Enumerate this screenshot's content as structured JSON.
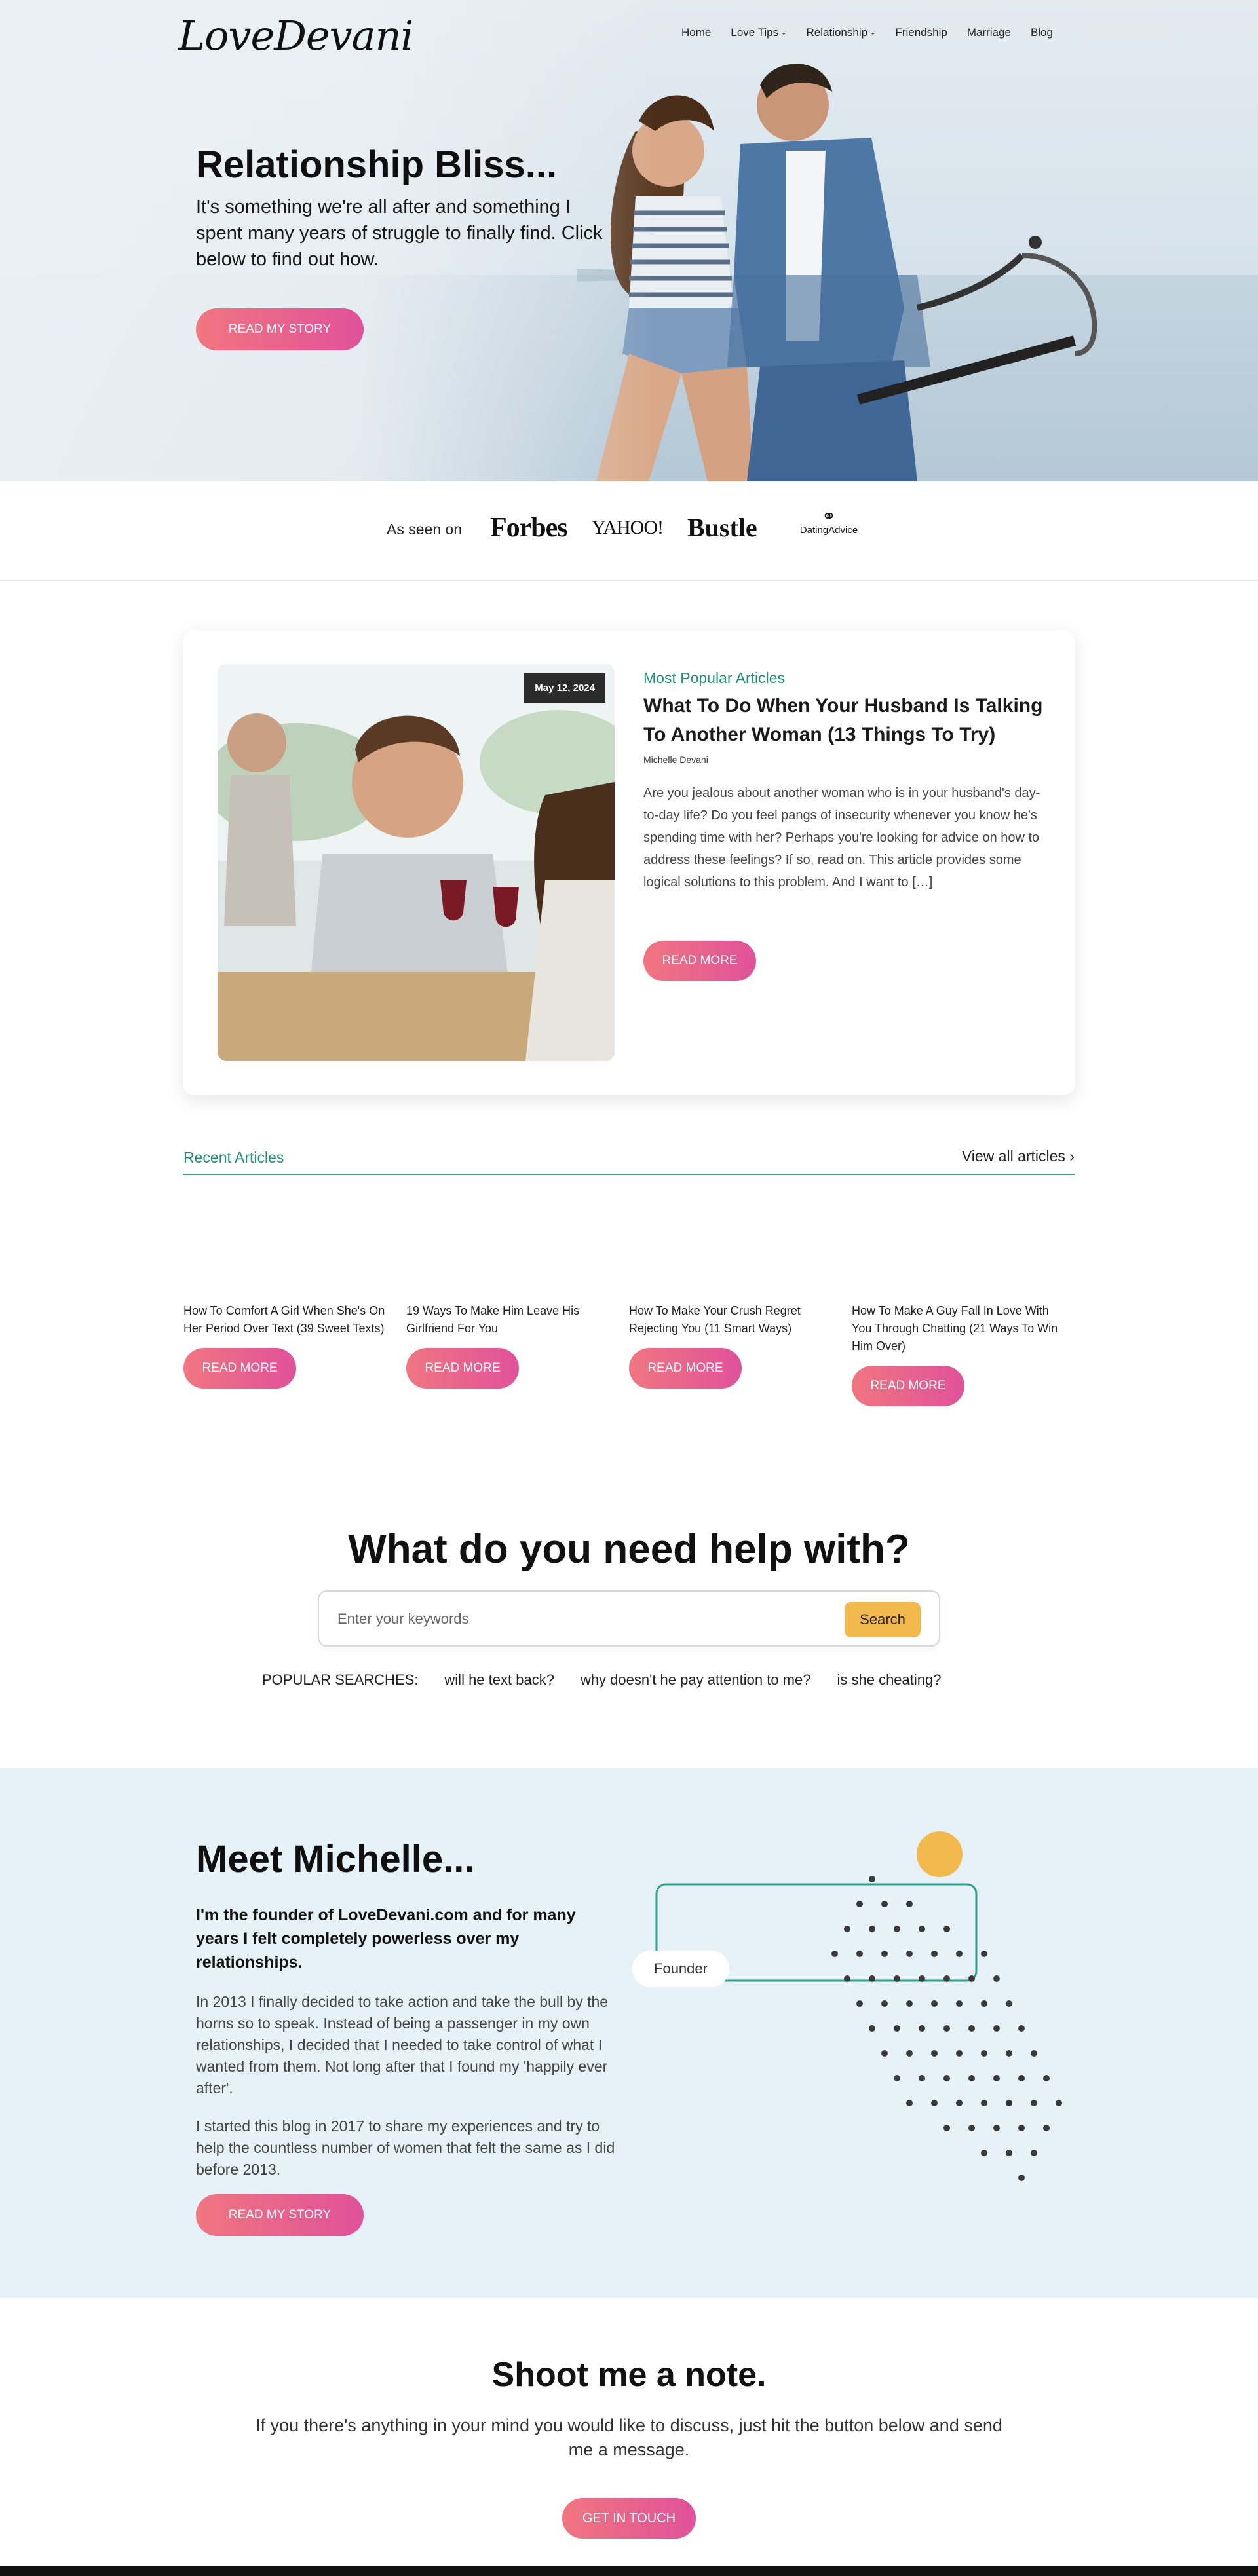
{
  "brand": {
    "logo": "LoveDevani"
  },
  "nav": {
    "items": [
      {
        "label": "Home",
        "has_dropdown": false
      },
      {
        "label": "Love Tips",
        "has_dropdown": true
      },
      {
        "label": "Relationship",
        "has_dropdown": true
      },
      {
        "label": "Friendship",
        "has_dropdown": false
      },
      {
        "label": "Marriage",
        "has_dropdown": false
      },
      {
        "label": "Blog",
        "has_dropdown": false
      }
    ]
  },
  "hero": {
    "title": "Relationship Bliss...",
    "subtitle": "It's something we're all after and something I spent many years of struggle to finally find. Click below to find out how.",
    "button": "READ MY STORY"
  },
  "seen_on": {
    "label": "As seen on",
    "brands": [
      "Forbes",
      "YAHOO!",
      "Bustle",
      "DatingAdvice"
    ]
  },
  "featured": {
    "date": "May 12, 2024",
    "kicker": "Most Popular Articles",
    "title": "What To Do When Your Husband Is Talking To Another Woman (13 Things To Try)",
    "author": "Michelle Devani",
    "excerpt": "Are you jealous about another woman who is in your husband's day-to-day life?  Do you feel pangs of insecurity whenever you know he's spending time with her? Perhaps you're looking for advice on how to address these feelings?  If so, read on. This article provides some logical solutions to this problem.  And I want to […]",
    "button": "READ MORE"
  },
  "recent": {
    "label": "Recent Articles",
    "view_all": "View all articles",
    "articles": [
      {
        "title": "How To Comfort A Girl When She's On Her Period Over Text (39 Sweet Texts)",
        "button": "READ MORE"
      },
      {
        "title": "19 Ways To Make Him Leave His Girlfriend For You",
        "button": "READ MORE"
      },
      {
        "title": "How To Make Your Crush Regret Rejecting You (11 Smart Ways)",
        "button": "READ MORE"
      },
      {
        "title": "How To Make A Guy Fall In Love With You Through Chatting (21 Ways To Win Him Over)",
        "button": "READ MORE"
      }
    ]
  },
  "help": {
    "title": "What do you need help with?",
    "placeholder": "Enter your keywords",
    "search_button": "Search",
    "popular_label": "POPULAR SEARCHES:",
    "popular": [
      "will he text back?",
      "why doesn't he pay attention to me?",
      "is she cheating?"
    ]
  },
  "meet": {
    "title": "Meet Michelle...",
    "lead": "I'm the founder of LoveDevani.com and for many years I felt completely powerless over my relationships.",
    "p1": "In 2013 I finally decided to take action and take the bull by the horns so to speak. Instead of being a passenger in my own relationships, I decided that I needed to take control of what I wanted from them. Not long after that I found my 'happily ever after'.",
    "p2": "I started this blog in 2017 to share my experiences and try to help the countless number of women that felt the same as I did before 2013.",
    "button": "READ MY STORY",
    "badge": "Founder"
  },
  "contact": {
    "title": "Shoot me a note.",
    "text": "If you there's anything in your mind you would like to discuss, just hit the button below and send me a message.",
    "button": "GET IN TOUCH"
  },
  "colors": {
    "accent_teal": "#1e9178",
    "button_gradient_start": "#f07680",
    "button_gradient_end": "#e0519a",
    "search_button": "#f2b84b",
    "meet_background": "#e6f1f8",
    "sun": "#f2b84b"
  }
}
